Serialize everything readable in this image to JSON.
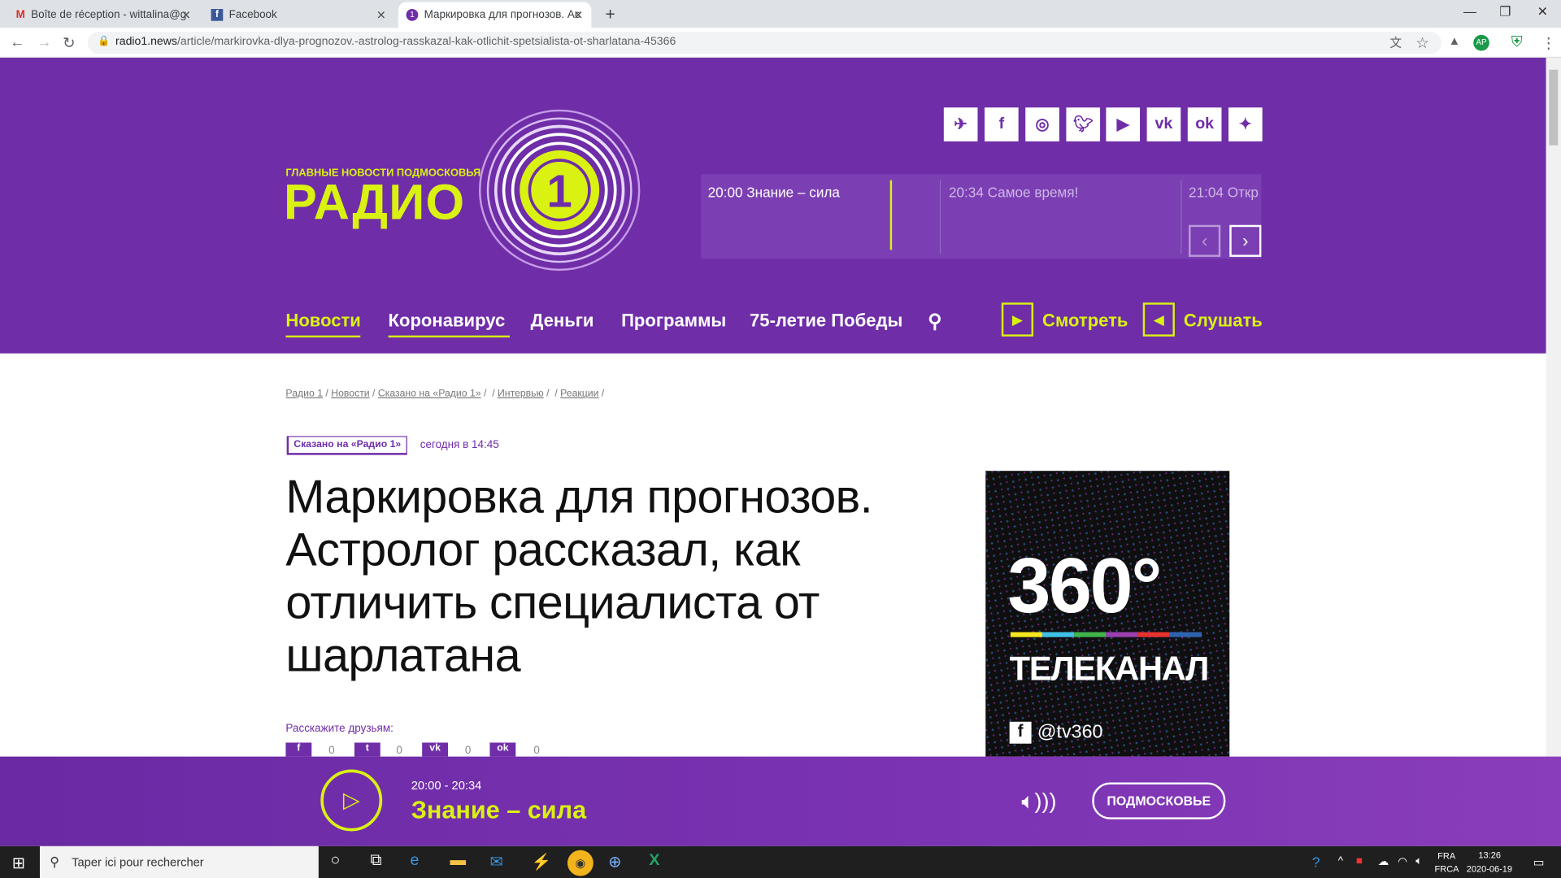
{
  "browser": {
    "tabs": [
      {
        "title": "Boîte de réception - wittalina@g",
        "favicon": "gmail-icon"
      },
      {
        "title": "Facebook",
        "favicon": "facebook-icon"
      },
      {
        "title": "Маркировка для прогнозов. Ас",
        "favicon": "radio1-icon"
      }
    ],
    "new_tab": "+",
    "url_host": "radio1.news",
    "url_path": "/article/markirovka-dlya-prognozov.-astrolog-rasskazal-kak-otlichit-spetsialista-ot-sharlatana-45366"
  },
  "site": {
    "tagline": "ГЛАВНЫЕ НОВОСТИ ПОДМОСКОВЬЯ",
    "logo_text": "РАДИО",
    "logo_number": "1",
    "social": [
      "telegram-icon",
      "facebook-icon",
      "instagram-icon",
      "twitter-icon",
      "youtube-icon",
      "vk-icon",
      "ok-icon",
      "zen-icon"
    ],
    "schedule": [
      {
        "text": "20:00 Знание – сила"
      },
      {
        "text": "20:34 Самое время!"
      },
      {
        "text": "21:04 Откр"
      }
    ],
    "nav": [
      "Новости",
      "Коронавирус",
      "Деньги",
      "Программы",
      "75-летие Победы"
    ],
    "watch": "Смотреть",
    "listen": "Слушать"
  },
  "article": {
    "breadcrumbs": [
      "Радио 1",
      "Новости",
      "Сказано на «Радио 1»",
      "",
      "Интервью",
      "",
      "Реакции",
      ""
    ],
    "category": "Сказано на «Радио 1»",
    "date": "сегодня в 14:45",
    "title": "Маркировка для прогнозов. Астролог рассказал, как отличить специалиста от шарлатана",
    "share_label": "Расскажите друзьям:",
    "share_counts": [
      "0",
      "0",
      "0",
      "0"
    ]
  },
  "ad": {
    "big": "360°",
    "sub": "ТЕЛЕКАНАЛ",
    "handle": "@tv360",
    "colors": [
      "#f5e61e",
      "#3ec1e6",
      "#3fb54a",
      "#9b3fb0",
      "#e8322f",
      "#2f63ae"
    ]
  },
  "player": {
    "time": "20:00 - 20:34",
    "show": "Знание – сила",
    "region": "ПОДМОСКОВЬЕ"
  },
  "taskbar": {
    "search_placeholder": "Taper ici pour rechercher",
    "lang1": "FRA",
    "lang2": "FRCA",
    "time": "13:26",
    "date": "2020-06-19"
  },
  "colors": {
    "brand": "#6f2da8",
    "accent": "#d9f212"
  }
}
